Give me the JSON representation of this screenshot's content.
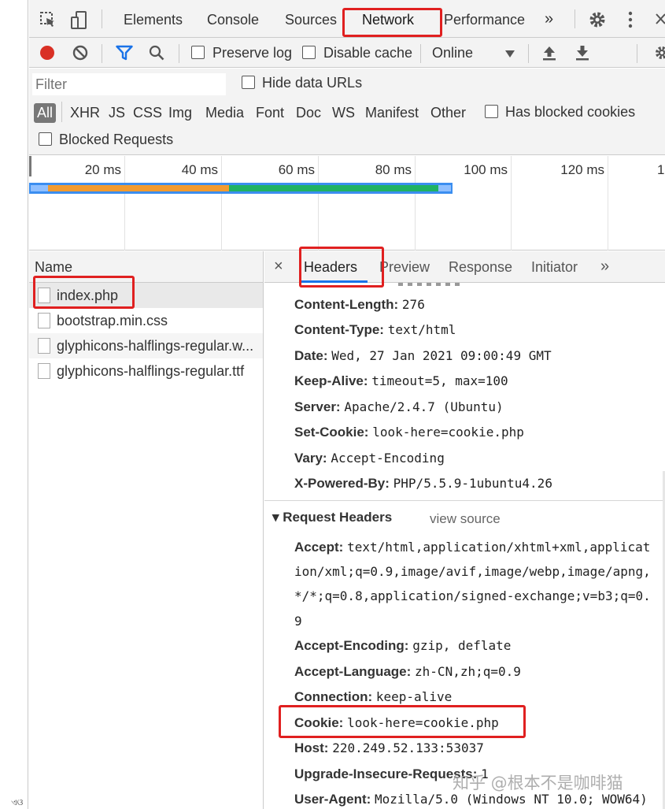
{
  "main_tabs": {
    "elements": "Elements",
    "console": "Console",
    "sources": "Sources",
    "network": "Network",
    "performance": "Performance",
    "more": "»"
  },
  "toolbar": {
    "preserve_log": "Preserve log",
    "disable_cache": "Disable cache",
    "throttle": "Online"
  },
  "filter": {
    "placeholder": "Filter",
    "hide_data_urls": "Hide data URLs",
    "types": [
      "All",
      "XHR",
      "JS",
      "CSS",
      "Img",
      "Media",
      "Font",
      "Doc",
      "WS",
      "Manifest",
      "Other"
    ],
    "has_blocked_cookies": "Has blocked cookies",
    "blocked_requests": "Blocked Requests"
  },
  "timeline": {
    "ticks": [
      "20 ms",
      "40 ms",
      "60 ms",
      "80 ms",
      "100 ms",
      "120 ms",
      "1"
    ]
  },
  "requests": {
    "header": "Name",
    "items": [
      "index.php",
      "bootstrap.min.css",
      "glyphicons-halflings-regular.w...",
      "glyphicons-halflings-regular.ttf"
    ]
  },
  "detail_tabs": {
    "close": "×",
    "headers": "Headers",
    "preview": "Preview",
    "response": "Response",
    "initiator": "Initiator",
    "more": "»"
  },
  "response_headers": [
    {
      "key": "Content-Length:",
      "value": "276"
    },
    {
      "key": "Content-Type:",
      "value": "text/html"
    },
    {
      "key": "Date:",
      "value": "Wed, 27 Jan 2021 09:00:49 GMT"
    },
    {
      "key": "Keep-Alive:",
      "value": "timeout=5, max=100"
    },
    {
      "key": "Server:",
      "value": "Apache/2.4.7 (Ubuntu)"
    },
    {
      "key": "Set-Cookie:",
      "value": "look-here=cookie.php"
    },
    {
      "key": "Vary:",
      "value": "Accept-Encoding"
    },
    {
      "key": "X-Powered-By:",
      "value": "PHP/5.5.9-1ubuntu4.26"
    }
  ],
  "request_section": {
    "title": "▾ Request Headers",
    "view_source": "view source"
  },
  "request_headers": {
    "accept_key": "Accept:",
    "accept_lines": [
      "text/html,application/xhtml+xml,applicat",
      "ion/xml;q=0.9,image/avif,image/webp,image/apng,",
      "*/*;q=0.8,application/signed-exchange;v=b3;q=0.",
      "9"
    ],
    "rest": [
      {
        "key": "Accept-Encoding:",
        "value": "gzip, deflate"
      },
      {
        "key": "Accept-Language:",
        "value": "zh-CN,zh;q=0.9"
      },
      {
        "key": "Connection:",
        "value": "keep-alive"
      },
      {
        "key": "Cookie:",
        "value": "look-here=cookie.php"
      },
      {
        "key": "Host:",
        "value": "220.249.52.133:53037"
      },
      {
        "key": "Upgrade-Insecure-Requests:",
        "value": "1"
      },
      {
        "key": "User-Agent:",
        "value": "Mozilla/5.0 (Windows NT 10.0; WOW64)"
      }
    ]
  },
  "watermark": "知乎 @根本不是咖啡猫",
  "corner_mark": "ଏଓ",
  "colors": {
    "record_red": "#d93025",
    "filter_blue": "#1a73e8",
    "highlight_red": "#e02020",
    "bar_orange": "#f29b30",
    "bar_green": "#1fb263",
    "bar_blue": "#3b8ef0"
  }
}
